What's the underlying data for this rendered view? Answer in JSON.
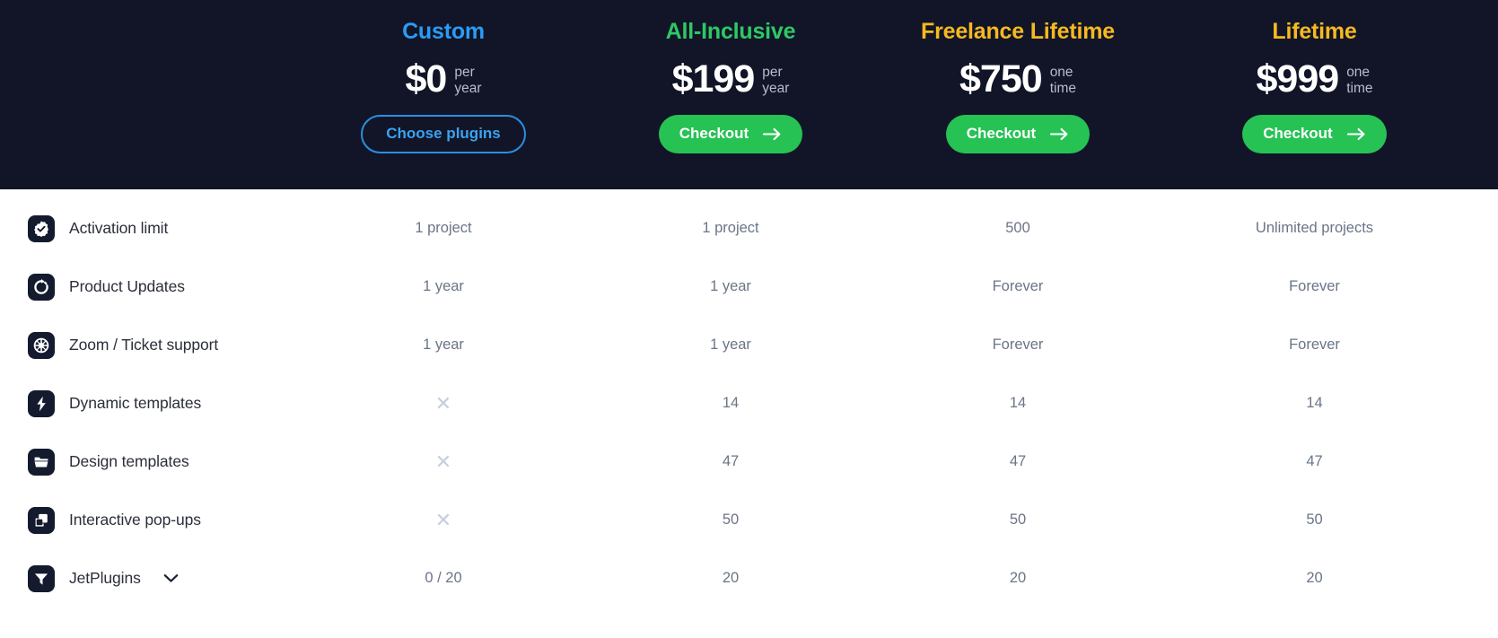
{
  "plans": [
    {
      "name": "Custom",
      "name_color": "#2b9bf4",
      "price": "$0",
      "period_line1": "per",
      "period_line2": "year",
      "cta_label": "Choose plugins",
      "cta_style": "outline",
      "cta_icon": ""
    },
    {
      "name": "All-Inclusive",
      "name_color": "#2ec866",
      "price": "$199",
      "period_line1": "per",
      "period_line2": "year",
      "cta_label": "Checkout",
      "cta_style": "solid",
      "cta_icon": "arrow-right-icon"
    },
    {
      "name": "Freelance Lifetime",
      "name_color": "#f7b920",
      "price": "$750",
      "period_line1": "one",
      "period_line2": "time",
      "cta_label": "Checkout",
      "cta_style": "solid",
      "cta_icon": "arrow-right-icon"
    },
    {
      "name": "Lifetime",
      "name_color": "#f7b920",
      "price": "$999",
      "period_line1": "one",
      "period_line2": "time",
      "cta_label": "Checkout",
      "cta_style": "solid",
      "cta_icon": "arrow-right-icon"
    }
  ],
  "features": [
    {
      "label": "Activation limit",
      "icon": "badge-check-icon",
      "expandable": false,
      "values": [
        "1 project",
        "1 project",
        "500",
        "Unlimited projects"
      ]
    },
    {
      "label": "Product Updates",
      "icon": "refresh-dashed-icon",
      "expandable": false,
      "values": [
        "1 year",
        "1 year",
        "Forever",
        "Forever"
      ]
    },
    {
      "label": "Zoom / Ticket support",
      "icon": "lifebuoy-icon",
      "expandable": false,
      "values": [
        "1 year",
        "1 year",
        "Forever",
        "Forever"
      ]
    },
    {
      "label": "Dynamic templates",
      "icon": "lightning-bolt-icon",
      "expandable": false,
      "values": [
        "✕",
        "14",
        "14",
        "14"
      ]
    },
    {
      "label": "Design templates",
      "icon": "folder-icon",
      "expandable": false,
      "values": [
        "✕",
        "47",
        "47",
        "47"
      ]
    },
    {
      "label": "Interactive pop-ups",
      "icon": "windows-stack-icon",
      "expandable": false,
      "values": [
        "✕",
        "50",
        "50",
        "50"
      ]
    },
    {
      "label": "JetPlugins",
      "icon": "funnel-icon",
      "expandable": true,
      "expand_icon": "chevron-down-icon",
      "values": [
        "0 / 20",
        "20",
        "20",
        "20"
      ]
    }
  ],
  "colors": {
    "header_bg": "#111527",
    "accent_blue": "#2b9bf4",
    "accent_green": "#27c254",
    "accent_yellow": "#f7b920",
    "value_text": "#6a7587",
    "cross_mark": "#c6cedd",
    "icon_tile": "#141b2e"
  }
}
